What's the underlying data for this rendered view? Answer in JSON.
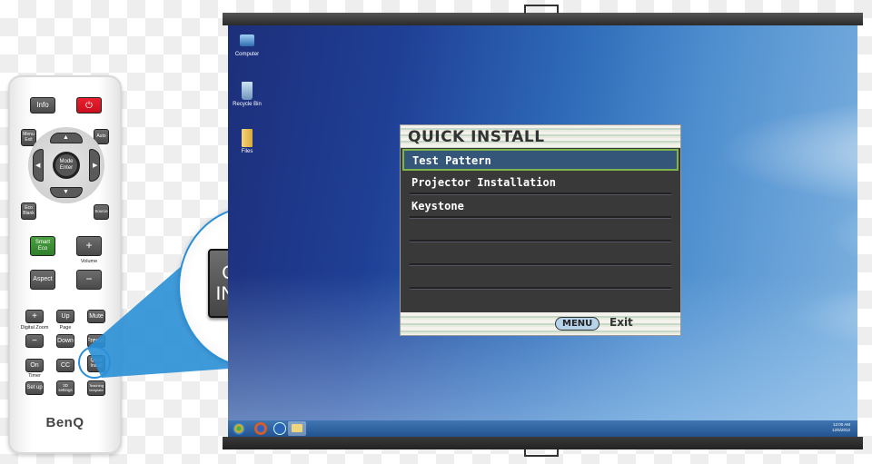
{
  "remote": {
    "brand": "BenQ",
    "buttons": {
      "info": "Info",
      "power": "⏻",
      "menu_exit": "Menu Exit",
      "auto": "Auto",
      "mode_enter": "Mode Enter",
      "eco_blank": "Eco Blank",
      "source": "Source",
      "smart_eco": "Smart Eco",
      "volume_plus": "+",
      "aspect": "Aspect",
      "volume_minus": "−",
      "zoom_plus": "+",
      "page_up": "Up",
      "mute": "Mute",
      "zoom_minus": "−",
      "page_down": "Down",
      "freeze": "Freeze",
      "timer_on": "On",
      "cc": "CC",
      "quick_install": "Quick Install",
      "setup": "Set up",
      "settings_3d": "3D settings",
      "teaching_template": "Teaching template"
    },
    "labels": {
      "volume": "Volume",
      "digital_zoom": "Digital Zoom",
      "page": "Page",
      "timer": "Timer"
    },
    "arrows": {
      "up": "▲",
      "down": "▼",
      "left": "◀",
      "right": "▶"
    }
  },
  "callout": {
    "button_label": "QUICK INSTALL"
  },
  "desktop": {
    "icons": [
      {
        "name": "computer",
        "label": "Computer"
      },
      {
        "name": "recycle-bin",
        "label": "Recycle Bin"
      },
      {
        "name": "files",
        "label": "Files"
      }
    ],
    "tray": {
      "time": "12:00 AM",
      "date": "12/6/2012"
    }
  },
  "osd": {
    "title": "QUICK INSTALL",
    "items": [
      "Test Pattern",
      "Projector Installation",
      "Keystone",
      "",
      "",
      ""
    ],
    "selected_index": 0,
    "footer": {
      "menu_key": "MENU",
      "action": "Exit"
    }
  },
  "colors": {
    "accent_blue": "#2a8fd6",
    "power_red": "#e41e2b",
    "eco_green": "#3d9236",
    "osd_select": "#345679",
    "osd_select_border": "#7fb54a"
  }
}
